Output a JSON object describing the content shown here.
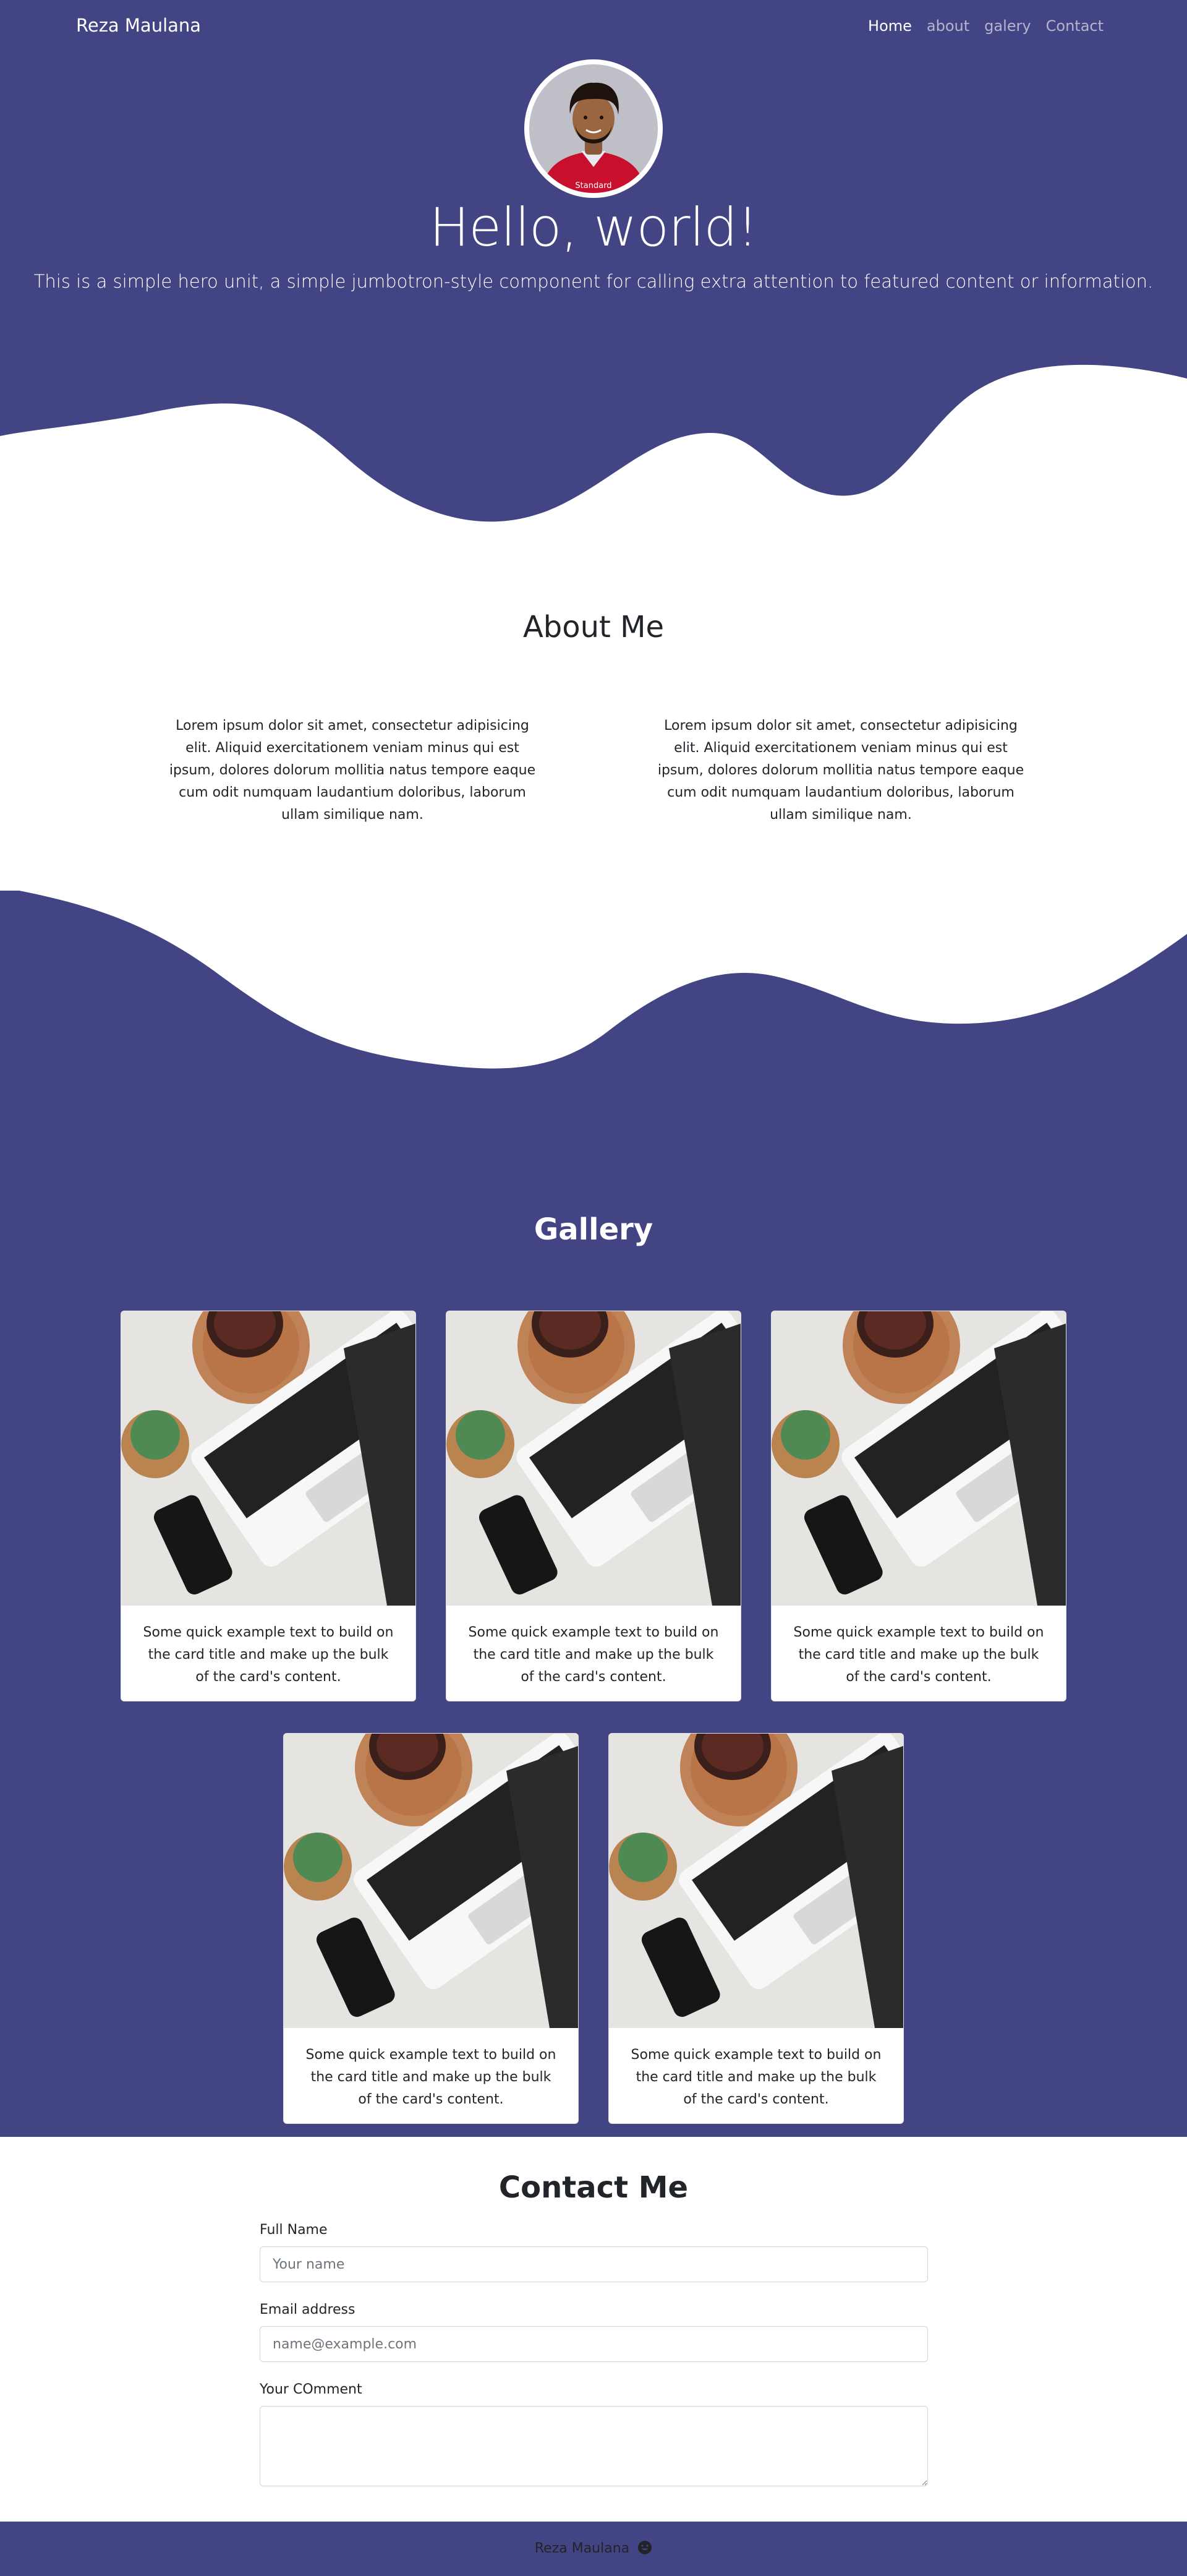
{
  "brand": "Reza Maulana",
  "nav": {
    "home": "Home",
    "about": "about",
    "gallery": "galery",
    "contact": "Contact"
  },
  "hero": {
    "title": "Hello, world!",
    "lead": "This is a simple hero unit, a simple jumbotron-style component for calling extra attention to featured content or information.",
    "avatar_shirt_text": "Standard"
  },
  "about": {
    "title": "About Me",
    "col1": "Lorem ipsum dolor sit amet, consectetur adipisicing elit. Aliquid exercitationem veniam minus qui est ipsum, dolores dolorum mollitia natus tempore eaque cum odit numquam laudantium doloribus, laborum ullam similique nam.",
    "col2": "Lorem ipsum dolor sit amet, consectetur adipisicing elit. Aliquid exercitationem veniam minus qui est ipsum, dolores dolorum mollitia natus tempore eaque cum odit numquam laudantium doloribus, laborum ullam similique nam."
  },
  "gallery": {
    "title": "Gallery",
    "cards": [
      {
        "text": "Some quick example text to build on the card title and make up the bulk of the card's content."
      },
      {
        "text": "Some quick example text to build on the card title and make up the bulk of the card's content."
      },
      {
        "text": "Some quick example text to build on the card title and make up the bulk of the card's content."
      },
      {
        "text": "Some quick example text to build on the card title and make up the bulk of the card's content."
      },
      {
        "text": "Some quick example text to build on the card title and make up the bulk of the card's content."
      }
    ]
  },
  "contact": {
    "title": "Contact Me",
    "name_label": "Full Name",
    "name_placeholder": "Your name",
    "email_label": "Email address",
    "email_placeholder": "name@example.com",
    "comment_label": "Your COmment"
  },
  "footer": {
    "text": "Reza Maulana"
  },
  "colors": {
    "primary": "#434483",
    "white": "#ffffff",
    "text": "#212529"
  },
  "icons": {
    "footer": "smile-icon"
  }
}
